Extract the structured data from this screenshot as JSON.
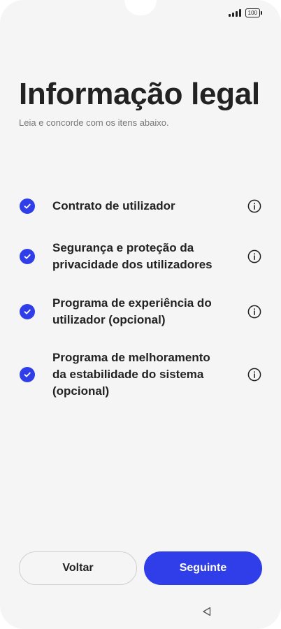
{
  "status_bar": {
    "battery": "100"
  },
  "title": "Informação legal",
  "subtitle": "Leia e concorde com os itens abaixo.",
  "items": [
    {
      "label": "Contrato de utilizador",
      "checked": true
    },
    {
      "label": "Segurança e proteção da privacidade dos utilizadores",
      "checked": true
    },
    {
      "label": "Programa de experiência do utilizador (opcional)",
      "checked": true
    },
    {
      "label": "Programa de melhoramento da estabilidade do sistema (opcional)",
      "checked": true
    }
  ],
  "buttons": {
    "back": "Voltar",
    "next": "Seguinte"
  },
  "colors": {
    "accent": "#2f3ee8",
    "background": "#f5f5f5",
    "text": "#222222"
  }
}
